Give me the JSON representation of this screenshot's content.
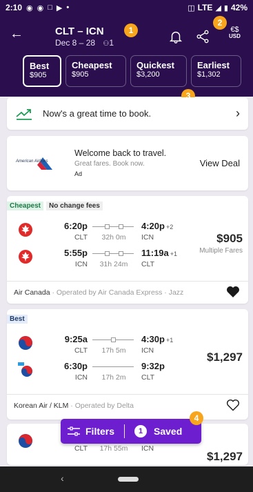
{
  "status": {
    "time": "2:10",
    "network": "LTE",
    "battery": "42%"
  },
  "header": {
    "route": "CLT – ICN",
    "dates": "Dec 8 – 28",
    "travelers": "1",
    "currency": "USD",
    "markers": [
      "1",
      "2",
      "3",
      "4"
    ]
  },
  "tabs": [
    {
      "label": "Best",
      "price": "$905"
    },
    {
      "label": "Cheapest",
      "price": "$905"
    },
    {
      "label": "Quickest",
      "price": "$3,200"
    },
    {
      "label": "Earliest",
      "price": "$1,302"
    }
  ],
  "tip": {
    "text": "Now's a great time to book."
  },
  "ad": {
    "brand": "American Airlines",
    "title": "Welcome back to travel.",
    "subtitle": "Great fares. Book now.",
    "tag": "Ad",
    "cta": "View Deal"
  },
  "flights": [
    {
      "tags": [
        "Cheapest",
        "No change fees"
      ],
      "legs": [
        {
          "dep": "6:20p",
          "dep_code": "CLT",
          "duration": "32h 0m",
          "arr": "4:20p",
          "plus": "+2",
          "arr_code": "ICN"
        },
        {
          "dep": "5:55p",
          "dep_code": "ICN",
          "duration": "31h 24m",
          "arr": "11:19a",
          "plus": "+1",
          "arr_code": "CLT"
        }
      ],
      "price": "$905",
      "price_note": "Multiple Fares",
      "carrier": "Air Canada",
      "operated": " · Operated by Air Canada Express · Jazz"
    },
    {
      "tags": [
        "Best"
      ],
      "legs": [
        {
          "dep": "9:25a",
          "dep_code": "CLT",
          "duration": "17h 5m",
          "arr": "4:30p",
          "plus": "+1",
          "arr_code": "ICN"
        },
        {
          "dep": "6:30p",
          "dep_code": "ICN",
          "duration": "17h 2m",
          "arr": "9:32p",
          "plus": "",
          "arr_code": "CLT"
        }
      ],
      "price": "$1,297",
      "carrier": "Korean Air / KLM",
      "operated": " · Operated by Delta"
    },
    {
      "legs": [
        {
          "dep_code": "CLT",
          "duration": "17h 55m",
          "arr_code": "ICN"
        }
      ],
      "price": "$1,297"
    }
  ],
  "filterbar": {
    "filters_label": "Filters",
    "saved_count": "1",
    "saved_label": "Saved"
  },
  "colors": {
    "brand": "#2a0e4e",
    "accent": "#6d1fd0",
    "marker": "#f7a51c"
  }
}
